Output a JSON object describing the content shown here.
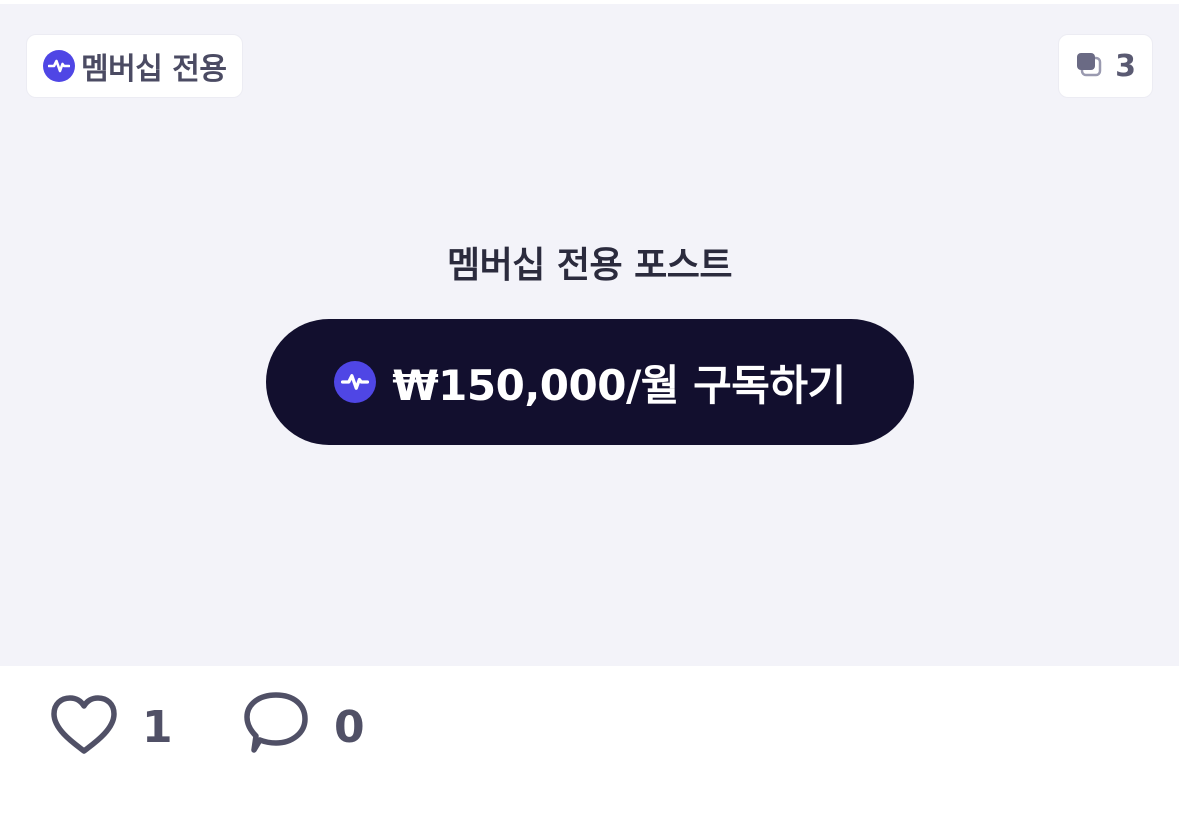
{
  "badge": {
    "icon": "activity-pulse-icon",
    "label": "멤버십 전용"
  },
  "images_count": {
    "icon": "stacked-images-icon",
    "value": "3"
  },
  "locked": {
    "title": "멤버십 전용 포스트",
    "subscribe_label": "₩150,000/월 구독하기",
    "subscribe_icon": "activity-pulse-icon"
  },
  "actions": {
    "like": {
      "icon": "heart-icon",
      "count": "1"
    },
    "comment": {
      "icon": "comment-bubble-icon",
      "count": "0"
    }
  },
  "colors": {
    "accent": "#4f46e5",
    "button_bg": "#120f2e",
    "locked_bg": "#f3f3f9",
    "muted_text": "#505066"
  }
}
